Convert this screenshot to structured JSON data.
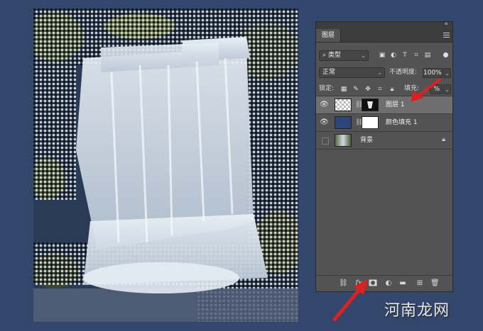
{
  "panel": {
    "tab_label": "图层",
    "filter": {
      "kind_label": "类型"
    },
    "blend_mode": "正常",
    "opacity_label": "不透明度:",
    "opacity_value": "100%",
    "lock_label": "锁定:",
    "fill_label": "填充:",
    "fill_value": "%",
    "layers": [
      {
        "name": "图层 1",
        "visible": true,
        "selected": true
      },
      {
        "name": "颜色填充 1",
        "visible": true,
        "selected": false,
        "fill_color": "#2d4677"
      },
      {
        "name": "背景",
        "visible": false,
        "selected": false
      }
    ],
    "bottom_icons": [
      "link-icon",
      "fx-icon",
      "add-mask-icon",
      "adjustment-layer-icon",
      "group-folder-icon",
      "new-layer-icon",
      "trash-icon"
    ],
    "fx_label": "fx"
  },
  "colors": {
    "background": "#33476d",
    "panel": "#535353",
    "arrow": "#e02020"
  },
  "watermark": "河南龙网"
}
